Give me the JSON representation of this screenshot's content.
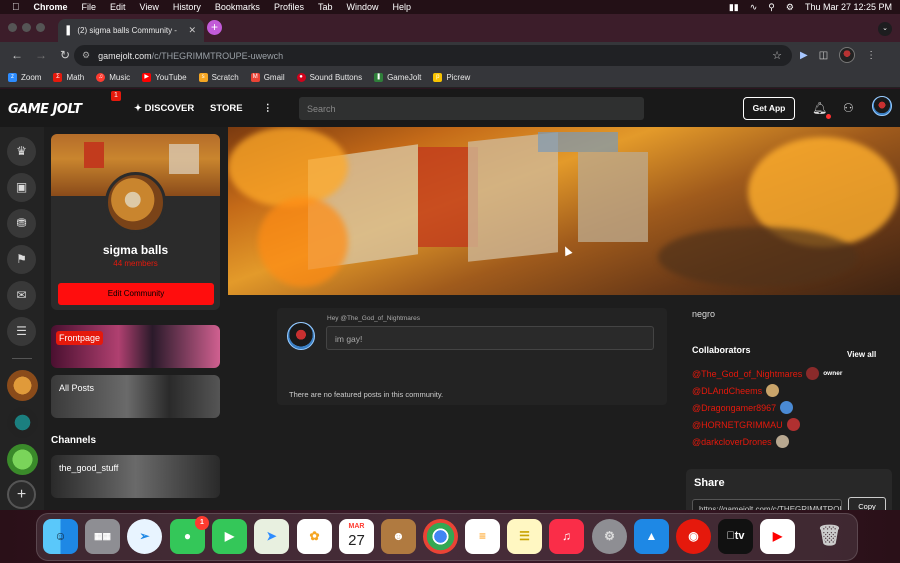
{
  "menubar": {
    "apple_icon": "apple-logo",
    "app_name": "Chrome",
    "items": [
      "File",
      "Edit",
      "View",
      "History",
      "Bookmarks",
      "Profiles",
      "Tab",
      "Window",
      "Help"
    ],
    "clock": "Thu Mar 27  12:25 PM"
  },
  "browser": {
    "tab_title": "(2) sigma balls Community - ",
    "url_host": "gamejolt.com",
    "url_path": "/c/THEGRIMMTROUPE-uwewch",
    "bookmarks": [
      {
        "label": "Zoom",
        "color": "#2d8cff",
        "icon": "zoom-icon"
      },
      {
        "label": "Math",
        "color": "#e5190c",
        "icon": "math-icon"
      },
      {
        "label": "Music",
        "color": "#ff3b30",
        "icon": "music-icon"
      },
      {
        "label": "YouTube",
        "color": "#ff0000",
        "icon": "youtube-icon"
      },
      {
        "label": "Scratch",
        "color": "#f5a623",
        "icon": "scratch-icon"
      },
      {
        "label": "Gmail",
        "color": "#ea4335",
        "icon": "gmail-icon"
      },
      {
        "label": "Sound Buttons",
        "color": "#d0021b",
        "icon": "sound-buttons-icon"
      },
      {
        "label": "GameJolt",
        "color": "#ccff00",
        "icon": "gamejolt-icon"
      },
      {
        "label": "Picrew",
        "color": "#f8c300",
        "icon": "picrew-icon"
      }
    ]
  },
  "gj": {
    "logo": "GAME JOLT",
    "notif_count": "1",
    "discover": "DISCOVER",
    "store": "STORE",
    "more": "⋮",
    "search_placeholder": "Search",
    "get_app": "Get App"
  },
  "community": {
    "name": "sigma balls",
    "members": "44 members",
    "edit_label": "Edit Community",
    "channels_heading": "Channels",
    "nav": [
      {
        "label": "Frontpage"
      },
      {
        "label": "All Posts"
      }
    ],
    "channels": [
      {
        "label": "the_good_stuff"
      }
    ],
    "post_hint": "Hey @The_God_of_Nightmares",
    "post_placeholder": "im gay!",
    "no_featured": "There are no featured posts in this community.",
    "description": "negro",
    "collaborators_heading": "Collaborators",
    "view_all": "View all",
    "owner_tag": "owner",
    "collaborators": [
      {
        "name": "@The_God_of_Nightmares",
        "avatar_color": "#8a2a2a"
      },
      {
        "name": "@DLAndCheems",
        "avatar_color": "#c9a46a"
      },
      {
        "name": "@Dragongamer8967",
        "avatar_color": "#4a8ad4"
      },
      {
        "name": "@HORNETGRIMMAU",
        "avatar_color": "#b03030"
      },
      {
        "name": "@darkcloverDrones",
        "avatar_color": "#b8a890"
      }
    ],
    "share_heading": "Share",
    "share_url": "https://gamejolt.com/c/THEGRIMMTROUPE-uwewch",
    "copy_label": "Copy"
  },
  "dock": {
    "calendar_month": "MAR",
    "calendar_day": "27",
    "messages_badge": "1"
  },
  "colors": {
    "accent": "#e5190c",
    "gj_bg": "#1d1d1d"
  }
}
